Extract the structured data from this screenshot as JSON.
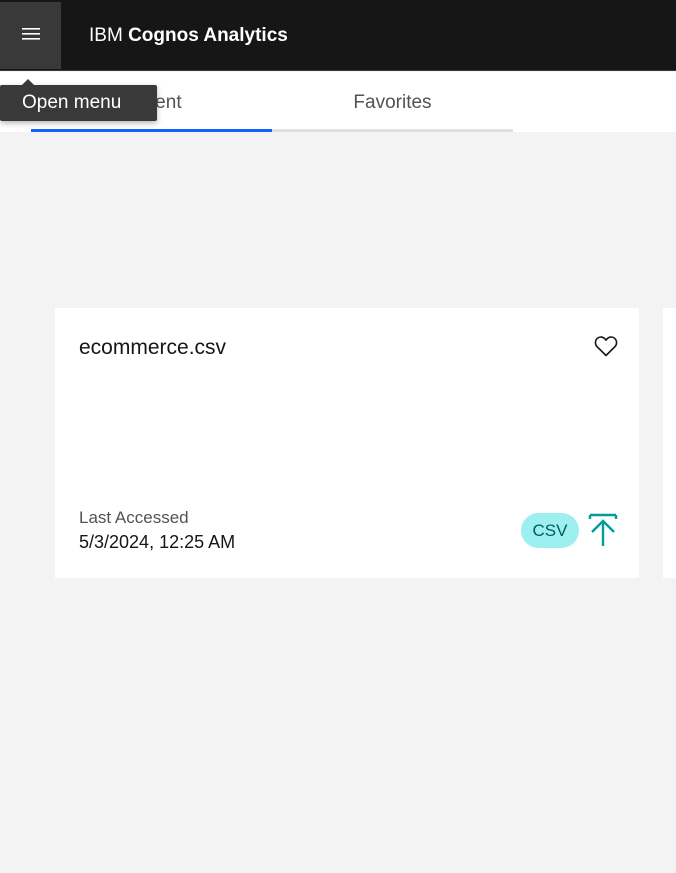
{
  "header": {
    "brand_light": "IBM",
    "brand_bold": "Cognos Analytics",
    "menu_icon": "hamburger-menu-icon",
    "background": "#161616"
  },
  "tooltip": {
    "text": "Open menu"
  },
  "tabs": [
    {
      "label": "Recent",
      "active": true
    },
    {
      "label": "Favorites",
      "active": false
    }
  ],
  "card": {
    "title": "ecommerce.csv",
    "favorite_icon": "heart-outline-icon",
    "meta_label": "Last Accessed",
    "meta_value": "5/3/2024, 12:25 AM",
    "type_badge": "CSV",
    "type_icon": "upload-icon",
    "accent": "#009d9a",
    "badge_color": "#9ef0f0"
  }
}
